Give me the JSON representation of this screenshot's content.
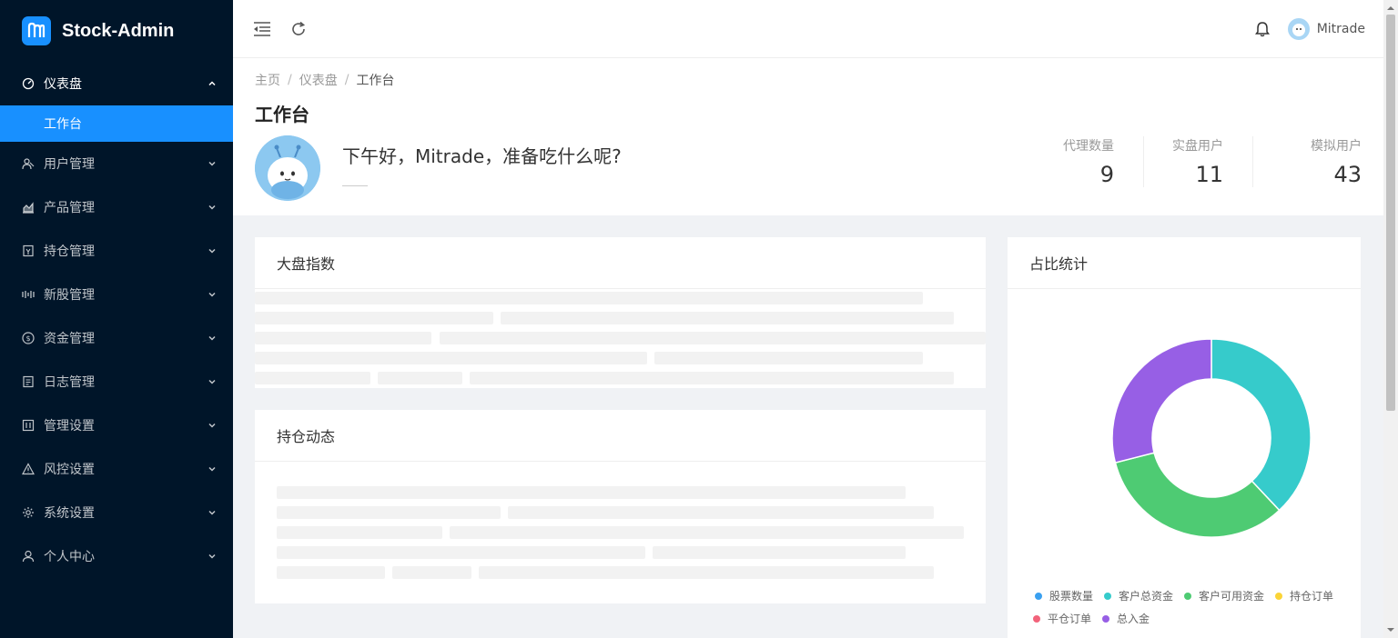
{
  "app": {
    "name": "Stock-Admin"
  },
  "sidebar": {
    "items": [
      {
        "label": "仪表盘",
        "icon": "dashboard-icon",
        "open": true
      },
      {
        "label": "用户管理",
        "icon": "users-icon"
      },
      {
        "label": "产品管理",
        "icon": "chart-area-icon"
      },
      {
        "label": "持仓管理",
        "icon": "position-icon"
      },
      {
        "label": "新股管理",
        "icon": "ipo-icon"
      },
      {
        "label": "资金管理",
        "icon": "dollar-icon"
      },
      {
        "label": "日志管理",
        "icon": "log-icon"
      },
      {
        "label": "管理设置",
        "icon": "settings-panel-icon"
      },
      {
        "label": "风控设置",
        "icon": "warning-icon"
      },
      {
        "label": "系统设置",
        "icon": "gear-icon"
      },
      {
        "label": "个人中心",
        "icon": "user-icon"
      }
    ],
    "active_sub": "工作台"
  },
  "header": {
    "username": "Mitrade"
  },
  "breadcrumb": [
    "主页",
    "仪表盘",
    "工作台"
  ],
  "page": {
    "title": "工作台",
    "greeting": "下午好，Mitrade，准备吃什么呢?"
  },
  "stats": [
    {
      "label": "代理数量",
      "value": "9"
    },
    {
      "label": "实盘用户",
      "value": "11"
    },
    {
      "label": "模拟用户",
      "value": "43"
    }
  ],
  "cards": {
    "market": "大盘指数",
    "positions": "持仓动态",
    "ratio": "占比统计"
  },
  "chart_data": {
    "type": "pie",
    "labels": [
      "股票数量",
      "客户总资金",
      "客户可用资金",
      "持仓订单",
      "平仓订单",
      "总入金"
    ],
    "values": [
      0,
      38,
      33,
      0,
      0,
      29
    ],
    "colors": [
      "#3aa0f0",
      "#36cbcb",
      "#4ecb73",
      "#fbd437",
      "#f2637b",
      "#975fe5"
    ],
    "legend": "bottom"
  }
}
